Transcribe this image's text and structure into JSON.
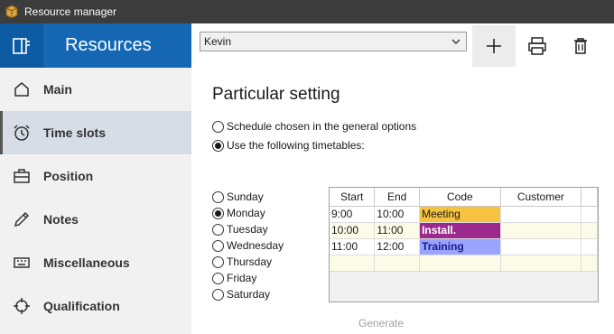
{
  "window": {
    "title": "Resource manager"
  },
  "sidebar": {
    "title": "Resources",
    "items": [
      {
        "label": "Main",
        "icon": "home-icon",
        "active": false
      },
      {
        "label": "Time slots",
        "icon": "alarm-clock-icon",
        "active": true
      },
      {
        "label": "Position",
        "icon": "briefcase-icon",
        "active": false
      },
      {
        "label": "Notes",
        "icon": "pencil-icon",
        "active": false
      },
      {
        "label": "Miscellaneous",
        "icon": "keyboard-icon",
        "active": false
      },
      {
        "label": "Qualification",
        "icon": "crosshair-icon",
        "active": false
      }
    ]
  },
  "toolbar": {
    "selected_resource": "Kevin",
    "add_icon": "plus-icon",
    "print_icon": "printer-icon",
    "delete_icon": "trash-icon"
  },
  "main": {
    "section_title": "Particular setting",
    "schedule_options": [
      {
        "label": "Schedule chosen in the general options",
        "checked": false
      },
      {
        "label": "Use the following timetables:",
        "checked": true
      }
    ],
    "days": [
      {
        "label": "Sunday",
        "checked": false
      },
      {
        "label": "Monday",
        "checked": true
      },
      {
        "label": "Tuesday",
        "checked": false
      },
      {
        "label": "Wednesday",
        "checked": false
      },
      {
        "label": "Thursday",
        "checked": false
      },
      {
        "label": "Friday",
        "checked": false
      },
      {
        "label": "Saturday",
        "checked": false
      }
    ],
    "table": {
      "columns": [
        "Start",
        "End",
        "Code",
        "Customer"
      ],
      "rows": [
        {
          "start": "9:00",
          "end": "10:00",
          "code": "Meeting",
          "code_color": "#f5c242",
          "code_text_color": "#1a1a1a",
          "code_bold": false,
          "customer": ""
        },
        {
          "start": "10:00",
          "end": "11:00",
          "code": "Install.",
          "code_color": "#9c2a8e",
          "code_text_color": "#ffffff",
          "code_bold": true,
          "customer": ""
        },
        {
          "start": "11:00",
          "end": "12:00",
          "code": "Training",
          "code_color": "#9aa3ff",
          "code_text_color": "#1a1a8c",
          "code_bold": true,
          "customer": ""
        },
        {
          "start": "",
          "end": "",
          "code": "",
          "code_color": "",
          "code_text_color": "",
          "code_bold": false,
          "customer": ""
        }
      ]
    },
    "generate_label": "Generate"
  }
}
